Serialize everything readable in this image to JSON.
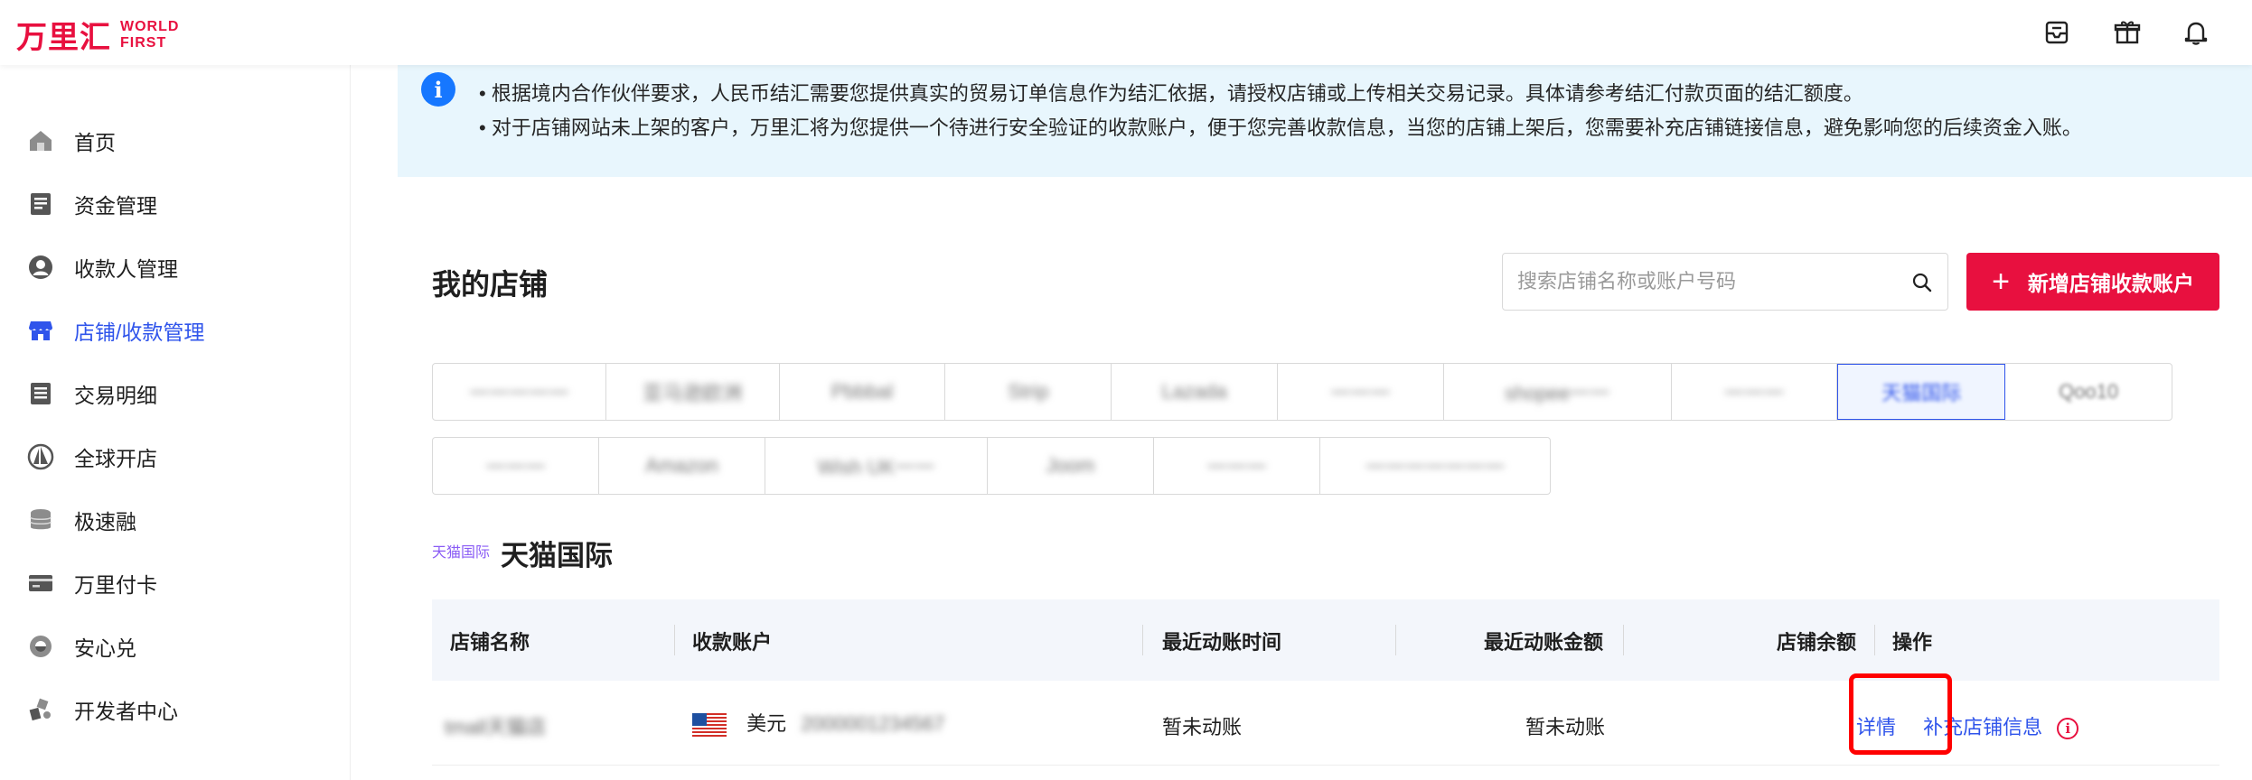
{
  "header": {
    "logo_cn": "万里汇",
    "logo_en_line1": "WORLD",
    "logo_en_line2": "FIRST",
    "icons": [
      "inbox-icon",
      "gift-icon",
      "bell-icon"
    ]
  },
  "sidebar": {
    "items": [
      {
        "label": "首页",
        "icon": "home-icon"
      },
      {
        "label": "资金管理",
        "icon": "document-icon"
      },
      {
        "label": "收款人管理",
        "icon": "user-icon"
      },
      {
        "label": "店铺/收款管理",
        "icon": "store-icon",
        "active": true
      },
      {
        "label": "交易明细",
        "icon": "list-icon"
      },
      {
        "label": "全球开店",
        "icon": "sail-icon"
      },
      {
        "label": "极速融",
        "icon": "coins-icon"
      },
      {
        "label": "万里付卡",
        "icon": "card-icon"
      },
      {
        "label": "安心兑",
        "icon": "exchange-icon"
      },
      {
        "label": "开发者中心",
        "icon": "developer-icon"
      }
    ],
    "active_color": "#2f54eb"
  },
  "banner": {
    "line1": "• 根据境内合作伙伴要求，人民币结汇需要您提供真实的贸易订单信息作为结汇依据，请授权店铺或上传相关交易记录。具体请参考结汇付款页面的结汇额度。",
    "line2": "• 对于店铺网站未上架的客户，万里汇将为您提供一个待进行安全验证的收款账户，便于您完善收款信息，当您的店铺上架后，您需要补充店铺链接信息，避免影响您的后续资金入账。"
  },
  "stores": {
    "title": "我的店铺",
    "search_placeholder": "搜索店铺名称或账户号码",
    "add_button": "新增店铺收款账户",
    "tabs_row1": [
      "一一一一一",
      "亚马逊欧洲",
      "Pbbbal",
      "Strip",
      "Lazada",
      "一一一",
      "shopee一一",
      "一一一",
      "天猫国际",
      "Qoo10"
    ],
    "tabs_row2": [
      "一一一",
      "Amazon",
      "Wish UK一一",
      "Joom",
      "一一一",
      "一一一一一一一"
    ],
    "selected_tab": "天猫国际"
  },
  "platform": {
    "logo_text": "天猫国际",
    "name": "天猫国际"
  },
  "table": {
    "headers": [
      "店铺名称",
      "收款账户",
      "最近动账时间",
      "最近动账金额",
      "店铺余额",
      "操作"
    ],
    "rows": [
      {
        "store_name": "tmall天猫店",
        "currency": "美元",
        "account": "2000001234567",
        "last_time": "暂未动账",
        "last_amount": "暂未动账",
        "balance": "",
        "action_detail": "详情",
        "action_supplement": "补充店铺信息"
      }
    ]
  },
  "colors": {
    "brand": "#e8103f",
    "link": "#2f54eb",
    "banner_bg": "#e8f6fd",
    "highlight": "#ff0000"
  }
}
